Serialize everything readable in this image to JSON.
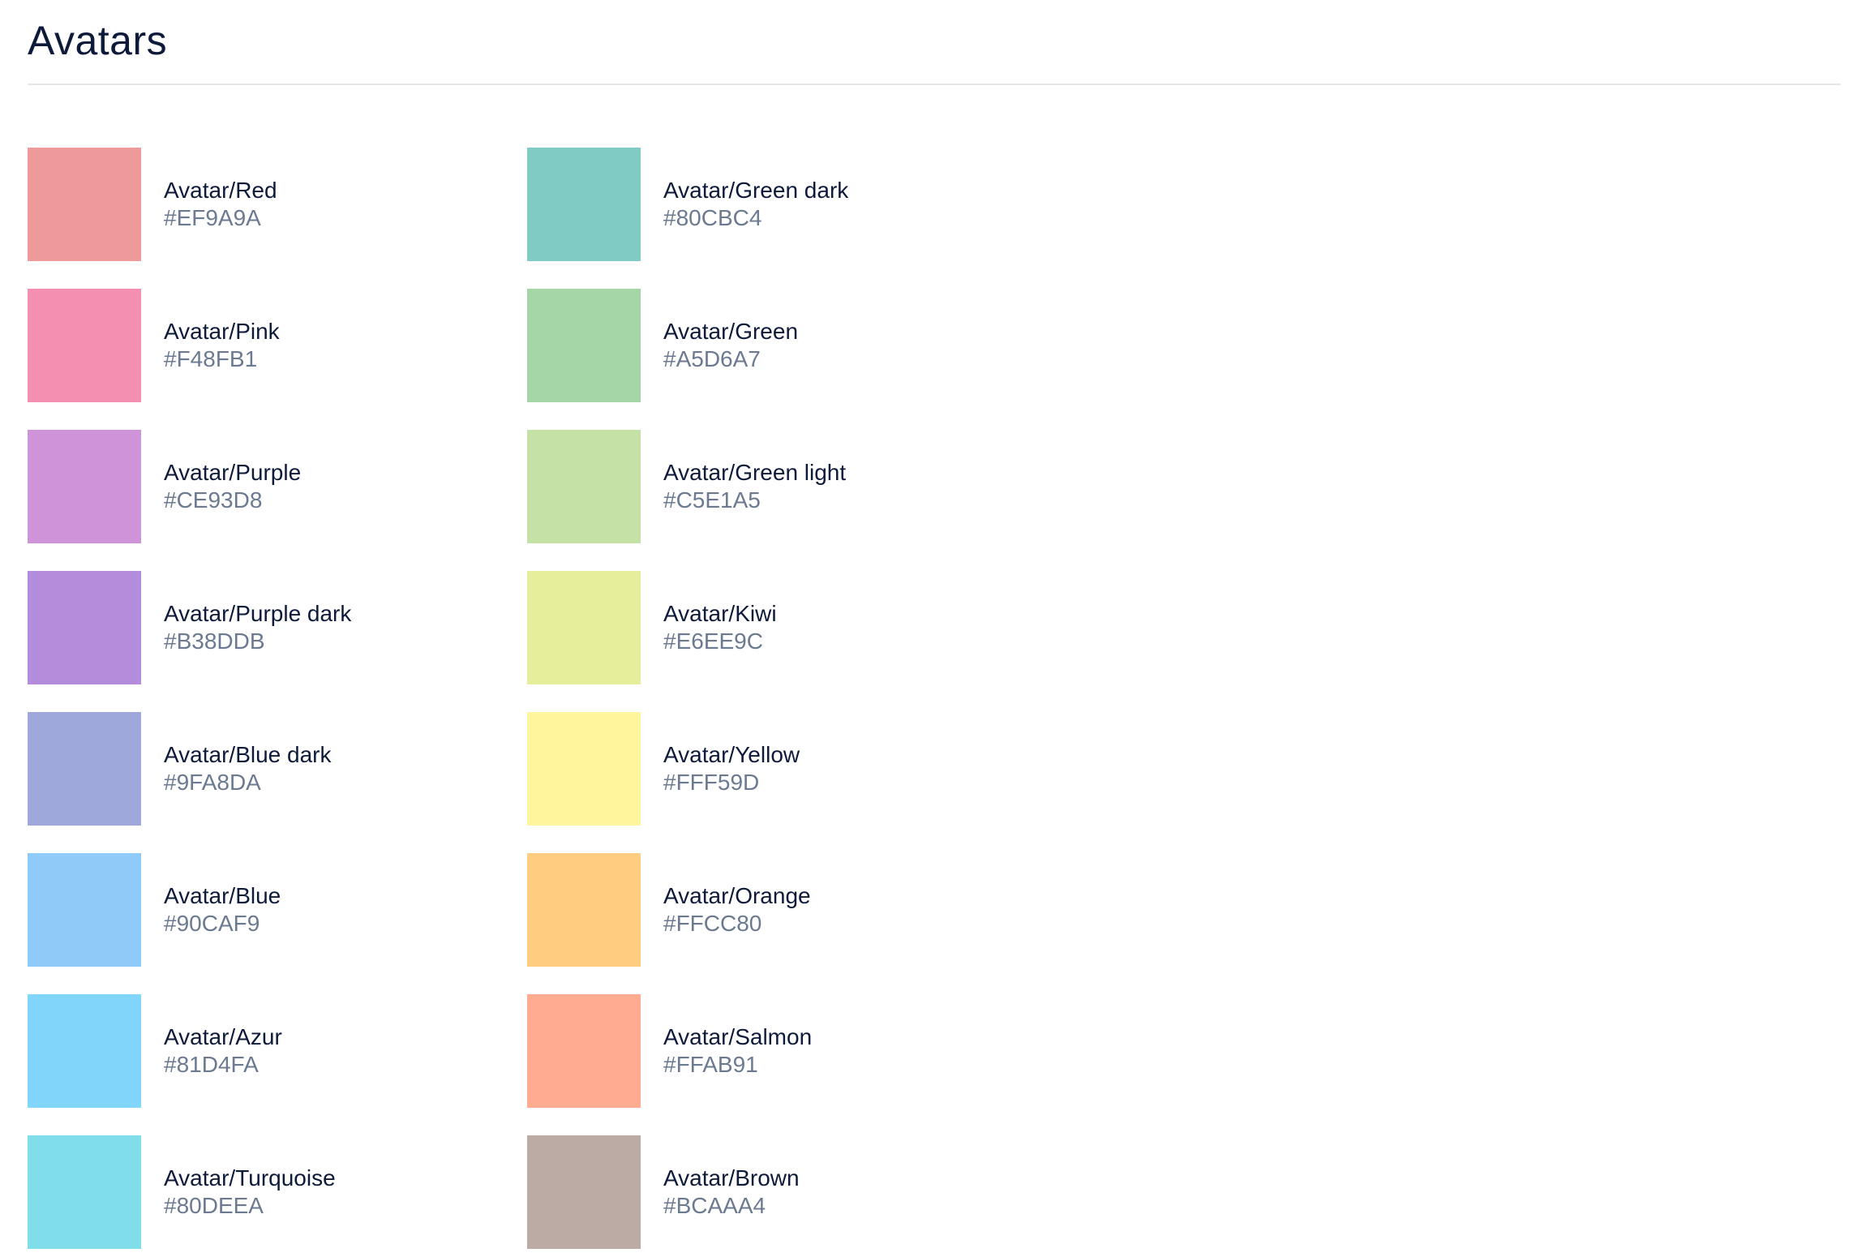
{
  "page": {
    "title": "Avatars"
  },
  "colors": {
    "title_text": "#0E1A3A",
    "hex_text": "#6B7A90",
    "divider": "#E3E6EB"
  },
  "swatches": [
    {
      "name": "Avatar/Red",
      "hex": "#EF9A9A"
    },
    {
      "name": "Avatar/Pink",
      "hex": "#F48FB1"
    },
    {
      "name": "Avatar/Purple",
      "hex": "#CE93D8"
    },
    {
      "name": "Avatar/Purple dark",
      "hex": "#B38DDB"
    },
    {
      "name": "Avatar/Blue dark",
      "hex": "#9FA8DA"
    },
    {
      "name": "Avatar/Blue",
      "hex": "#90CAF9"
    },
    {
      "name": "Avatar/Azur",
      "hex": "#81D4FA"
    },
    {
      "name": "Avatar/Turquoise",
      "hex": "#80DEEA"
    },
    {
      "name": "Avatar/Green dark",
      "hex": "#80CBC4"
    },
    {
      "name": "Avatar/Green",
      "hex": "#A5D6A7"
    },
    {
      "name": "Avatar/Green light",
      "hex": "#C5E1A5"
    },
    {
      "name": "Avatar/Kiwi",
      "hex": "#E6EE9C"
    },
    {
      "name": "Avatar/Yellow",
      "hex": "#FFF59D"
    },
    {
      "name": "Avatar/Orange",
      "hex": "#FFCC80"
    },
    {
      "name": "Avatar/Salmon",
      "hex": "#FFAB91"
    },
    {
      "name": "Avatar/Brown",
      "hex": "#BCAAA4"
    }
  ]
}
